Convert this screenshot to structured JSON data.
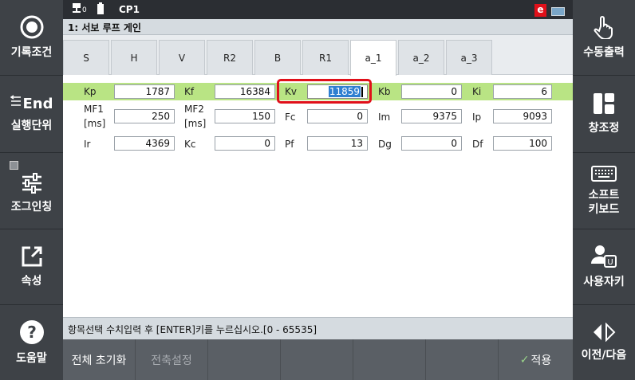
{
  "status_bar": {
    "io_label": "0",
    "robot_name": "CP1",
    "mode_badge": "e"
  },
  "title": "1: 서보 루프 게인",
  "tabs": [
    "S",
    "H",
    "V",
    "R2",
    "B",
    "R1",
    "a_1",
    "a_2",
    "a_3"
  ],
  "active_tab": "a_1",
  "params": {
    "Kp": "1787",
    "Kf": "16384",
    "Kv": "11859",
    "Kb": "0",
    "Ki": "6",
    "MF1": "250",
    "MF2": "150",
    "Fc": "0",
    "Im": "9375",
    "Ip": "9093",
    "Ir": "4369",
    "Kc": "0",
    "Pf": "13",
    "Dg": "0",
    "Df": "100"
  },
  "labels": {
    "Kp": "Kp",
    "Kf": "Kf",
    "Kv": "Kv",
    "Kb": "Kb",
    "Ki": "Ki",
    "MF1_a": "MF1",
    "MF1_b": "[ms]",
    "MF2_a": "MF2",
    "MF2_b": "[ms]",
    "Fc": "Fc",
    "Im": "Im",
    "Ip": "Ip",
    "Ir": "Ir",
    "Kc": "Kc",
    "Pf": "Pf",
    "Dg": "Dg",
    "Df": "Df"
  },
  "message": "항목선택 수치입력 후 [ENTER]키를 누르십시오.[0 - 65535]",
  "bottom_buttons": {
    "reset_all": "전체 초기화",
    "axis_setting": "전축설정",
    "apply": "적용"
  },
  "left_menu": {
    "record_condition": "기록조건",
    "exec_unit": "실행단위",
    "end_label": "End",
    "jog_inching": "조그인칭",
    "properties": "속성",
    "help": "도움말"
  },
  "right_menu": {
    "manual_output": "수동출력",
    "window_adjust": "창조정",
    "soft_keyboard": "소프트\n키보드",
    "user_key": "사용자키",
    "prev_next": "이전/다음"
  },
  "colors": {
    "highlight_row": "#b9e484",
    "selection_box": "#e0101a",
    "selected_text_bg": "#2f7fd1"
  }
}
